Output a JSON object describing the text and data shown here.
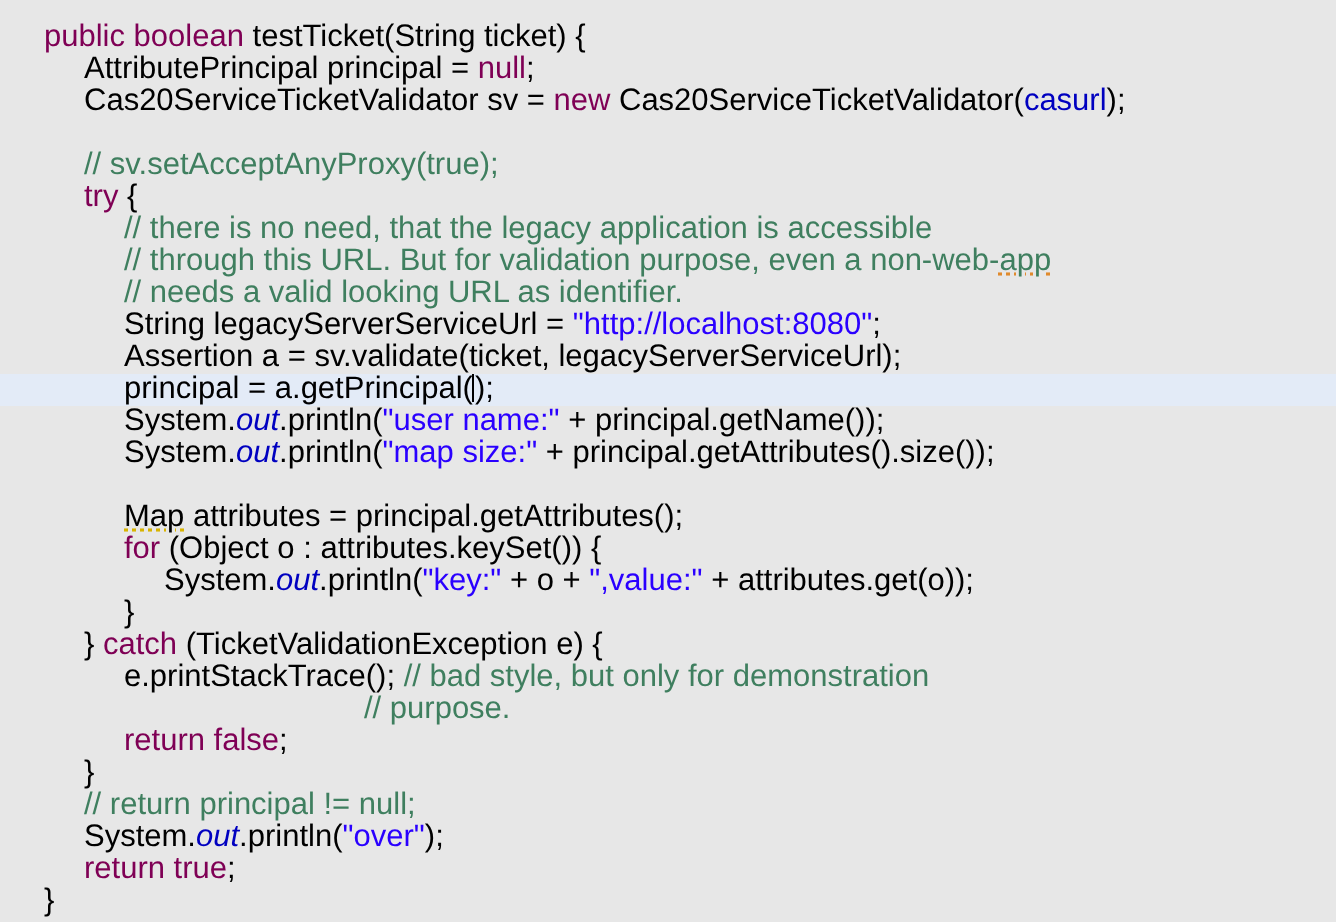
{
  "editor": {
    "lines": [
      {
        "kind": "code",
        "current": false,
        "tokens": [
          {
            "kind": "keyword",
            "text": "public boolean"
          },
          {
            "kind": "plain",
            "text": " testTicket(String ticket) {"
          }
        ]
      },
      {
        "kind": "code",
        "current": false,
        "tokens": [
          {
            "kind": "plain",
            "text": "\tAttributePrincipal principal = "
          },
          {
            "kind": "keyword",
            "text": "null"
          },
          {
            "kind": "plain",
            "text": ";"
          }
        ]
      },
      {
        "kind": "code",
        "current": false,
        "tokens": [
          {
            "kind": "plain",
            "text": "\tCas20ServiceTicketValidator sv = "
          },
          {
            "kind": "keyword",
            "text": "new"
          },
          {
            "kind": "plain",
            "text": " Cas20ServiceTicketValidator("
          },
          {
            "kind": "field",
            "text": "casurl"
          },
          {
            "kind": "plain",
            "text": ");"
          }
        ]
      },
      {
        "kind": "blank"
      },
      {
        "kind": "code",
        "current": false,
        "tokens": [
          {
            "kind": "comment",
            "text": "\t// sv.setAcceptAnyProxy(true);"
          }
        ]
      },
      {
        "kind": "code",
        "current": false,
        "tokens": [
          {
            "kind": "keyword",
            "text": "\ttry"
          },
          {
            "kind": "plain",
            "text": " {"
          }
        ]
      },
      {
        "kind": "code",
        "current": false,
        "tokens": [
          {
            "kind": "comment",
            "text": "\t\t// there is no need, that the legacy application is accessible"
          }
        ]
      },
      {
        "kind": "code",
        "current": false,
        "tokens": [
          {
            "kind": "comment",
            "text": "\t\t// through this URL. But for validation purpose, even a non-web-"
          },
          {
            "kind": "spelling",
            "text": "app"
          }
        ]
      },
      {
        "kind": "code",
        "current": false,
        "tokens": [
          {
            "kind": "comment",
            "text": "\t\t// needs a valid looking URL as identifier."
          }
        ]
      },
      {
        "kind": "code",
        "current": false,
        "tokens": [
          {
            "kind": "plain",
            "text": "\t\tString legacyServerServiceUrl = "
          },
          {
            "kind": "string",
            "text": "\"http://localhost:8080\""
          },
          {
            "kind": "plain",
            "text": ";"
          }
        ]
      },
      {
        "kind": "code",
        "current": false,
        "tokens": [
          {
            "kind": "plain",
            "text": "\t\tAssertion a = sv.validate(ticket, legacyServerServiceUrl);"
          }
        ]
      },
      {
        "kind": "code",
        "current": true,
        "tokens": [
          {
            "kind": "plain",
            "text": "\t\tprincipal = a.getPrincipal("
          },
          {
            "kind": "caret"
          },
          {
            "kind": "plain",
            "text": ");"
          }
        ]
      },
      {
        "kind": "code",
        "current": false,
        "tokens": [
          {
            "kind": "plain",
            "text": "\t\tSystem."
          },
          {
            "kind": "static",
            "text": "out"
          },
          {
            "kind": "plain",
            "text": ".println("
          },
          {
            "kind": "string",
            "text": "\"user name:\""
          },
          {
            "kind": "plain",
            "text": " + principal.getName());"
          }
        ]
      },
      {
        "kind": "code",
        "current": false,
        "tokens": [
          {
            "kind": "plain",
            "text": "\t\tSystem."
          },
          {
            "kind": "static",
            "text": "out"
          },
          {
            "kind": "plain",
            "text": ".println("
          },
          {
            "kind": "string",
            "text": "\"map size:\""
          },
          {
            "kind": "plain",
            "text": " + principal.getAttributes().size());"
          }
        ]
      },
      {
        "kind": "blank"
      },
      {
        "kind": "code",
        "current": false,
        "tokens": [
          {
            "kind": "warning",
            "text": "\t\tMap"
          },
          {
            "kind": "plain",
            "text": " attributes = principal.getAttributes();"
          }
        ]
      },
      {
        "kind": "code",
        "current": false,
        "tokens": [
          {
            "kind": "keyword",
            "text": "\t\tfor"
          },
          {
            "kind": "plain",
            "text": " (Object o : attributes.keySet()) {"
          }
        ]
      },
      {
        "kind": "code",
        "current": false,
        "tokens": [
          {
            "kind": "plain",
            "text": "\t\t\tSystem."
          },
          {
            "kind": "static",
            "text": "out"
          },
          {
            "kind": "plain",
            "text": ".println("
          },
          {
            "kind": "string",
            "text": "\"key:\""
          },
          {
            "kind": "plain",
            "text": " + o + "
          },
          {
            "kind": "string",
            "text": "\",value:\""
          },
          {
            "kind": "plain",
            "text": " + attributes.get(o));"
          }
        ]
      },
      {
        "kind": "code",
        "current": false,
        "tokens": [
          {
            "kind": "plain",
            "text": "\t\t}"
          }
        ]
      },
      {
        "kind": "code",
        "current": false,
        "tokens": [
          {
            "kind": "plain",
            "text": "\t} "
          },
          {
            "kind": "keyword",
            "text": "catch"
          },
          {
            "kind": "plain",
            "text": " (TicketValidationException e) {"
          }
        ]
      },
      {
        "kind": "code",
        "current": false,
        "tokens": [
          {
            "kind": "plain",
            "text": "\t\te.printStackTrace(); "
          },
          {
            "kind": "comment",
            "text": "// bad style, but only for demonstration"
          }
        ]
      },
      {
        "kind": "code",
        "current": false,
        "tokens": [
          {
            "kind": "comment",
            "text": "\t\t\t\t\t\t\t\t// purpose."
          }
        ]
      },
      {
        "kind": "code",
        "current": false,
        "tokens": [
          {
            "kind": "keyword",
            "text": "\t\treturn false"
          },
          {
            "kind": "plain",
            "text": ";"
          }
        ]
      },
      {
        "kind": "code",
        "current": false,
        "tokens": [
          {
            "kind": "plain",
            "text": "\t}"
          }
        ]
      },
      {
        "kind": "code",
        "current": false,
        "tokens": [
          {
            "kind": "comment",
            "text": "\t// return principal != null;"
          }
        ]
      },
      {
        "kind": "code",
        "current": false,
        "tokens": [
          {
            "kind": "plain",
            "text": "\tSystem."
          },
          {
            "kind": "static",
            "text": "out"
          },
          {
            "kind": "plain",
            "text": ".println("
          },
          {
            "kind": "string",
            "text": "\"over\""
          },
          {
            "kind": "plain",
            "text": ");"
          }
        ]
      },
      {
        "kind": "code",
        "current": false,
        "tokens": [
          {
            "kind": "keyword",
            "text": "\treturn true"
          },
          {
            "kind": "plain",
            "text": ";"
          }
        ]
      },
      {
        "kind": "code",
        "current": false,
        "tokens": [
          {
            "kind": "plain",
            "text": "}"
          }
        ]
      }
    ]
  }
}
